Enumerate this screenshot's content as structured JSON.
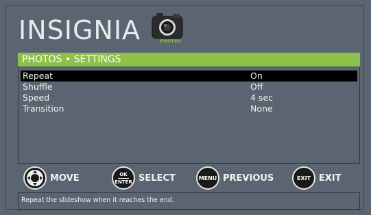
{
  "brand": {
    "logo_text": "INSIGNIA",
    "source_label": "PHOTOS"
  },
  "colors": {
    "background": "#5b6571",
    "accent": "#8dc14a",
    "selected_row": "#000000"
  },
  "menu": {
    "title": "PHOTOS • SETTINGS",
    "items": [
      {
        "label": "Repeat",
        "value": "On",
        "selected": true
      },
      {
        "label": "Shuffle",
        "value": "Off",
        "selected": false
      },
      {
        "label": "Speed",
        "value": "4 sec",
        "selected": false
      },
      {
        "label": "Transition",
        "value": "None",
        "selected": false
      }
    ]
  },
  "help": {
    "move": {
      "icon": "dpad-icon",
      "label": "MOVE"
    },
    "select": {
      "icon_top": "OK",
      "icon_bottom": "ENTER",
      "label": "SELECT"
    },
    "previous": {
      "icon": "MENU",
      "label": "PREVIOUS"
    },
    "exit": {
      "icon": "EXIT",
      "label": "EXIT"
    }
  },
  "status_text": "Repeat the slideshow when it reaches the end."
}
